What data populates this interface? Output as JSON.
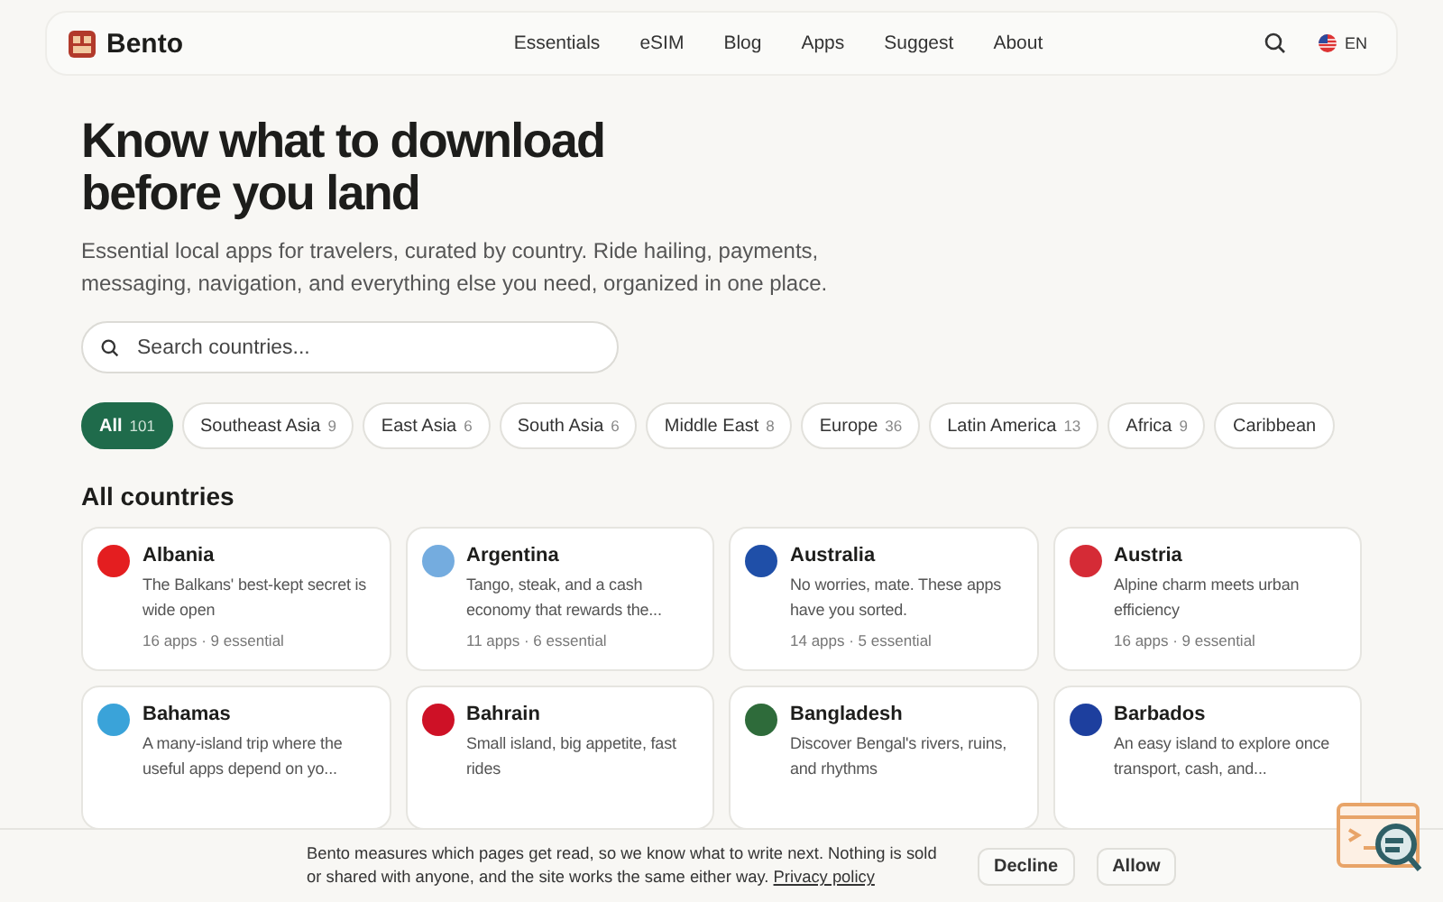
{
  "brand": "Bento",
  "nav": [
    "Essentials",
    "eSIM",
    "Blog",
    "Apps",
    "Suggest",
    "About"
  ],
  "language": "EN",
  "hero": {
    "title": "Know what to download before you land",
    "subtitle": "Essential local apps for travelers, curated by country. Ride hailing, payments, messaging, navigation, and everything else you need, organized in one place."
  },
  "search": {
    "placeholder": "Search countries..."
  },
  "filters": [
    {
      "label": "All",
      "count": "101",
      "selected": true
    },
    {
      "label": "Southeast Asia",
      "count": "9",
      "selected": false
    },
    {
      "label": "East Asia",
      "count": "6",
      "selected": false
    },
    {
      "label": "South Asia",
      "count": "6",
      "selected": false
    },
    {
      "label": "Middle East",
      "count": "8",
      "selected": false
    },
    {
      "label": "Europe",
      "count": "36",
      "selected": false
    },
    {
      "label": "Latin America",
      "count": "13",
      "selected": false
    },
    {
      "label": "Africa",
      "count": "9",
      "selected": false
    },
    {
      "label": "Caribbean",
      "selected": false
    }
  ],
  "section_title": "All countries",
  "countries": [
    {
      "name": "Albania",
      "color": "#e41e20",
      "description": "The Balkans' best-kept secret is wide open",
      "meta": "16 apps · 9 essential"
    },
    {
      "name": "Argentina",
      "color": "#74acdf",
      "description": "Tango, steak, and a cash economy that rewards the...",
      "meta": "11 apps · 6 essential"
    },
    {
      "name": "Australia",
      "color": "#1f4fa8",
      "description": "No worries, mate. These apps have you sorted.",
      "meta": "14 apps · 5 essential"
    },
    {
      "name": "Austria",
      "color": "#d52b36",
      "description": "Alpine charm meets urban efficiency",
      "meta": "16 apps · 9 essential"
    },
    {
      "name": "Bahamas",
      "color": "#3aa3d9",
      "description": "A many-island trip where the useful apps depend on yo..."
    },
    {
      "name": "Bahrain",
      "color": "#ce1126",
      "description": "Small island, big appetite, fast rides"
    },
    {
      "name": "Bangladesh",
      "color": "#2e6b3a",
      "description": "Discover Bengal's rivers, ruins, and rhythms"
    },
    {
      "name": "Barbados",
      "color": "#1d3f9e",
      "description": "An easy island to explore once transport, cash, and..."
    }
  ],
  "consent": {
    "text": "Bento measures which pages get read, so we know what to write next. Nothing is sold or shared with anyone, and the site works the same either way.",
    "link": "Privacy policy",
    "buttons": [
      "Decline",
      "Allow"
    ]
  }
}
